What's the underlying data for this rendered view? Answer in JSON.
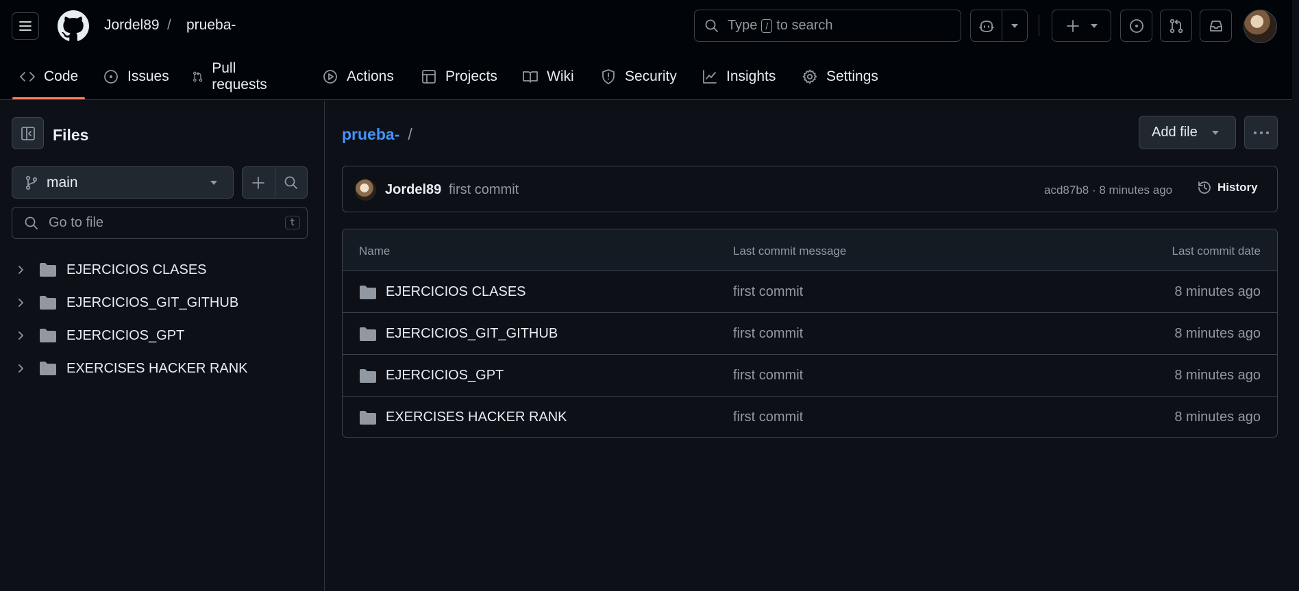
{
  "header": {
    "owner": "Jordel89",
    "separator": "/",
    "repo": "prueba-",
    "search_placeholder_prefix": "Type",
    "search_key": "/",
    "search_placeholder_suffix": "to search"
  },
  "repo_nav": {
    "tabs": [
      {
        "label": "Code",
        "icon": "code-icon",
        "active": true
      },
      {
        "label": "Issues",
        "icon": "issue-opened-icon"
      },
      {
        "label": "Pull requests",
        "icon": "git-pull-request-icon"
      },
      {
        "label": "Actions",
        "icon": "play-icon"
      },
      {
        "label": "Projects",
        "icon": "table-icon"
      },
      {
        "label": "Wiki",
        "icon": "book-icon"
      },
      {
        "label": "Security",
        "icon": "shield-icon"
      },
      {
        "label": "Insights",
        "icon": "graph-icon"
      },
      {
        "label": "Settings",
        "icon": "gear-icon"
      }
    ]
  },
  "sidebar": {
    "title": "Files",
    "branch": "main",
    "goto_placeholder": "Go to file",
    "goto_shortcut": "t",
    "tree": [
      {
        "label": "EJERCICIOS CLASES"
      },
      {
        "label": "EJERCICIOS_GIT_GITHUB"
      },
      {
        "label": "EJERCICIOS_GPT"
      },
      {
        "label": "EXERCISES HACKER RANK"
      }
    ]
  },
  "main": {
    "breadcrumb_repo": "prueba-",
    "breadcrumb_sep": "/",
    "add_file_label": "Add file",
    "commit": {
      "author": "Jordel89",
      "message": "first commit",
      "meta": "acd87b8 · 8 minutes ago",
      "history_label": "History"
    },
    "table": {
      "headers": {
        "name": "Name",
        "message": "Last commit message",
        "date": "Last commit date"
      },
      "rows": [
        {
          "name": "EJERCICIOS CLASES",
          "message": "first commit",
          "date": "8 minutes ago"
        },
        {
          "name": "EJERCICIOS_GIT_GITHUB",
          "message": "first commit",
          "date": "8 minutes ago"
        },
        {
          "name": "EJERCICIOS_GPT",
          "message": "first commit",
          "date": "8 minutes ago"
        },
        {
          "name": "EXERCISES HACKER RANK",
          "message": "first commit",
          "date": "8 minutes ago"
        }
      ]
    }
  },
  "colors": {
    "background": "#0d1117",
    "header_bg": "#010409",
    "link_blue": "#4493f8",
    "active_underline": "#f78166"
  }
}
